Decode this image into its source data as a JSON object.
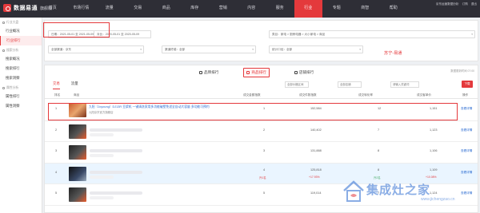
{
  "app": {
    "title": "数据易通",
    "edition": "旗舰版"
  },
  "nav": [
    "首页",
    "市场行情",
    "流量",
    "交易",
    "商品",
    "库存",
    "营销",
    "内容",
    "服务",
    "行业",
    "专题",
    "商智",
    "帮助"
  ],
  "nav_active_index": 9,
  "top_right": [
    "京东运营数据分析",
    "订购",
    "退出"
  ],
  "sidebar": {
    "groups": [
      {
        "title": "行业大盘",
        "items": [
          "行业概况",
          "行业排行"
        ]
      },
      {
        "title": "搜索分析",
        "items": [
          "搜索概况",
          "搜索排行",
          "搜索洞察"
        ]
      },
      {
        "title": "属性分析",
        "items": [
          "属性排行",
          "属性洞察"
        ]
      }
    ],
    "active_item": "行业排行"
  },
  "filters": {
    "date": "日期：2021-05-01 至 2021-05-09",
    "compare": "对比：2020-05-01 至 2020-05-09",
    "category": "类目：家电 > 厨房电器 > 大小家电 > 商品",
    "channel": "全部渠道：京东",
    "client": "渠道终端：全部",
    "type": "统计口径：全部"
  },
  "annotation": "苏宁-易通",
  "rank_tabs": [
    "品牌排行",
    "商品排行",
    "店铺排行"
  ],
  "rank_tab_active": 1,
  "updated": "数据更新时间 07:00",
  "sub_tabs": [
    "交易",
    "流量"
  ],
  "sub_tab_active": 0,
  "selects": [
    "全部价格区间",
    "全部店铺",
    "请输入关键词"
  ],
  "download": "下载",
  "table": {
    "headers": [
      "排名",
      "商品",
      "成交金额指数",
      "成交件数指数",
      "成交转化率",
      "成交客单价",
      "操作"
    ],
    "rows": [
      {
        "rank": "1",
        "name": "九阳（Joyoung）DJ13R 豆浆机 一键清洗家用多功能破壁免滤全自动大容量 多功能可预约",
        "shop": "九阳京东官方旗舰店",
        "gmv": "1",
        "units": "152,584",
        "conv": "12",
        "aov": "1,151",
        "gmv_delta": "",
        "units_delta": "",
        "conv_delta": "",
        "aov_delta": "",
        "action": "查看详情"
      },
      {
        "rank": "2",
        "name": "",
        "shop": "",
        "gmv": "2",
        "units": "140,402",
        "conv": "7",
        "aov": "1,123",
        "gmv_delta": "",
        "units_delta": "",
        "conv_delta": "",
        "aov_delta": "",
        "action": "查看详情"
      },
      {
        "rank": "3",
        "name": "",
        "shop": "",
        "gmv": "3",
        "units": "131,888",
        "conv": "8",
        "aov": "1,106",
        "gmv_delta": "",
        "units_delta": "",
        "conv_delta": "",
        "aov_delta": "",
        "action": "查看详情"
      },
      {
        "rank": "4",
        "name": "",
        "shop": "",
        "gmv": "4",
        "units": "125,818",
        "conv": "8",
        "aov": "1,109",
        "gmv_delta": "升1名",
        "units_delta": "+17.93%",
        "conv_delta": "升2名",
        "aov_delta": "+10.08%",
        "action": "查看详情"
      },
      {
        "rank": "5",
        "name": "",
        "shop": "",
        "gmv": "5",
        "units": "119,014",
        "conv": "7",
        "aov": "1,124",
        "gmv_delta": "",
        "units_delta": "",
        "conv_delta": "",
        "aov_delta": "",
        "action": "查看详情"
      }
    ]
  },
  "watermark": {
    "text": "集成灶之家",
    "url": "www.jichengzao.cn"
  },
  "colors": {
    "accent": "#e4393c",
    "topbar": "#2e2e36",
    "link": "#2b6bd1"
  }
}
